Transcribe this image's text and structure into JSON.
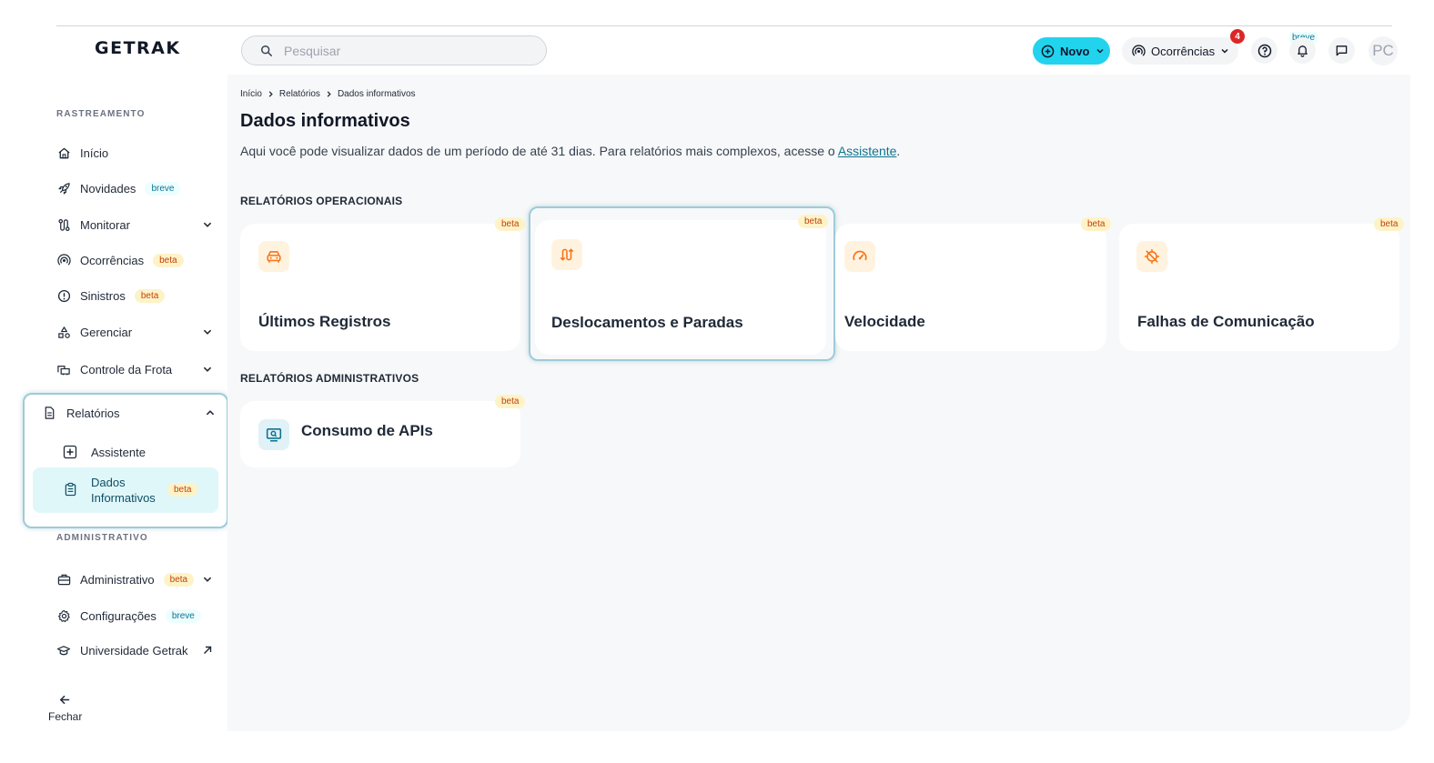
{
  "app": {
    "logo": "GETRAK"
  },
  "search": {
    "placeholder": "Pesquisar"
  },
  "header": {
    "novo_label": "Novo",
    "ocorrencias_label": "Ocorrências",
    "notification_count": "4",
    "breve_label": "breve",
    "avatar_initials": "PC"
  },
  "sidebar": {
    "section_rastreamento": "RASTREAMENTO",
    "section_administrativo": "ADMINISTRATIVO",
    "items": {
      "inicio": "Início",
      "novidades": "Novidades",
      "novidades_tag": "breve",
      "monitorar": "Monitorar",
      "ocorrencias": "Ocorrências",
      "ocorrencias_tag": "beta",
      "sinistros": "Sinistros",
      "sinistros_tag": "beta",
      "gerenciar": "Gerenciar",
      "controle_frota": "Controle da Frota",
      "relatorios": "Relatórios",
      "assistente": "Assistente",
      "dados_informativos_1": "Dados",
      "dados_informativos_2": "Informativos",
      "dados_tag": "beta",
      "administrativo": "Administrativo",
      "administrativo_tag": "beta",
      "configuracoes": "Configurações",
      "configuracoes_tag": "breve",
      "universidade": "Universidade Getrak"
    },
    "fechar": "Fechar"
  },
  "main": {
    "breadcrumb": [
      "Início",
      "Relatórios",
      "Dados informativos"
    ],
    "title": "Dados informativos",
    "description": "Aqui você pode visualizar dados de um período de até 31 dias. Para relatórios mais complexos, acesse o ",
    "description_link": "Assistente",
    "description_end": ".",
    "operacionais_title": "RELATÓRIOS OPERACIONAIS",
    "administrativos_title": "RELATÓRIOS ADMINISTRATIVOS",
    "cards": {
      "ultimos": "Últimos Registros",
      "deslocamentos": "Deslocamentos e Paradas",
      "velocidade": "Velocidade",
      "falhas": "Falhas de Comunicação",
      "apis": "Consumo de APIs"
    },
    "beta_tag": "beta"
  },
  "colors": {
    "accent": "#22d3ee",
    "highlight_border": "#9ecbd9",
    "icon_orange": "#f97316",
    "icon_teal": "#0e7490"
  }
}
